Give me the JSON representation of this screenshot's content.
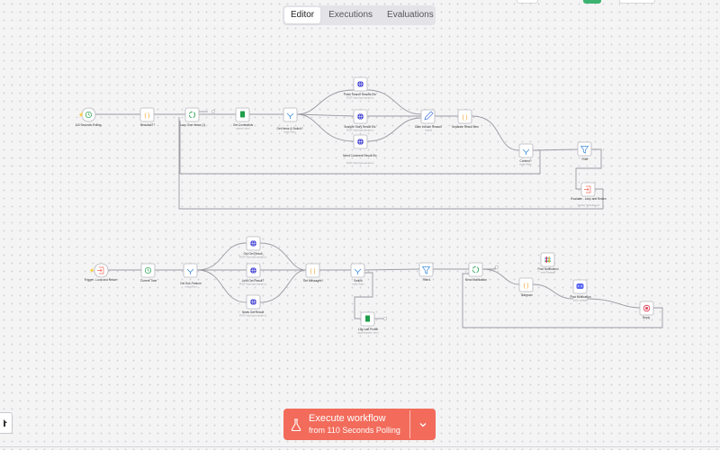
{
  "tabs": [
    {
      "label": "Editor",
      "active": true
    },
    {
      "label": "Executions",
      "active": false
    },
    {
      "label": "Evaluations",
      "active": false
    }
  ],
  "execute": {
    "title": "Execute workflow",
    "subtitle": "from 110 Seconds Polling"
  },
  "colors": {
    "accent": "#f26b5b",
    "trigger": "#f26b5b",
    "http": "#4a4ad6",
    "code": "#f29a1a",
    "sheets": "#1e9e4a",
    "filter": "#3c8ddb",
    "loop": "#1e9e4a",
    "edit": "#3c6fd6",
    "discord": "#5865f2",
    "stop": "#d9304a"
  },
  "nodes": [
    {
      "id": "poll",
      "icon": "clock-icon",
      "label": "110 Seconds Polling",
      "sub": ""
    },
    {
      "id": "result1",
      "icon": "code-icon",
      "label": "ResultsAT?",
      "sub": ""
    },
    {
      "id": "loop1",
      "icon": "loop-icon",
      "label": "Loop Over Items (1)",
      "sub": ""
    },
    {
      "id": "getcontent",
      "icon": "sheets-icon",
      "label": "Get Contentfuls",
      "sub": "append: sheet"
    },
    {
      "id": "getnews",
      "icon": "split-icon",
      "label": "Get News & Switch?",
      "sub": "mode: Rules"
    },
    {
      "id": "fetch",
      "icon": "globe-icon",
      "label": "Fetch Search Results Etc",
      "sub": "POST: https://api.example.io"
    },
    {
      "id": "analyze",
      "icon": "globe-icon",
      "label": "Analyze Story Result Etc",
      "sub": "POST: https://api.example.io"
    },
    {
      "id": "need",
      "icon": "globe-icon",
      "label": "Need Comment Result Etc",
      "sub": "POST: https://api.example.io"
    },
    {
      "id": "editreason",
      "icon": "pencil-icon",
      "label": "Date Include Reason",
      "sub": "manual"
    },
    {
      "id": "separate",
      "icon": "code-icon",
      "label": "Separate Result Item",
      "sub": ""
    },
    {
      "id": "content",
      "icon": "split-icon",
      "label": "Content?",
      "sub": "mode: Rules"
    },
    {
      "id": "filter1",
      "icon": "filter-icon",
      "label": "Filter",
      "sub": ""
    },
    {
      "id": "evaluate",
      "icon": "exit-icon",
      "label": "Evaluate - Loop and Return",
      "sub": "Reorder: Write/Returns"
    },
    {
      "id": "trigger",
      "icon": "exit-icon",
      "label": "Trigger - Loop and Return",
      "sub": ""
    },
    {
      "id": "current",
      "icon": "clock-icon",
      "label": "Current Time",
      "sub": ""
    },
    {
      "id": "getsub",
      "icon": "split-icon",
      "label": "Get Sub-Feature",
      "sub": "mode: Rules"
    },
    {
      "id": "get1",
      "icon": "globe-icon",
      "label": "Get Get Result",
      "sub": "POST: https://api.example.io"
    },
    {
      "id": "get2",
      "icon": "globe-icon",
      "label": "Joint Get Result?",
      "sub": "POST: https://api.example.io"
    },
    {
      "id": "get3",
      "icon": "globe-icon",
      "label": "News Get Result",
      "sub": "POST: https://api.example.io"
    },
    {
      "id": "getmsg",
      "icon": "code-icon",
      "label": "Get Messages?",
      "sub": ""
    },
    {
      "id": "switch",
      "icon": "split-icon",
      "label": "Switch",
      "sub": "mode: Rules"
    },
    {
      "id": "logprofile",
      "icon": "sheets-icon",
      "label": "Log Last Profile",
      "sub": "append/update: sheet"
    },
    {
      "id": "filter2",
      "icon": "filter-icon",
      "label": "Filter1",
      "sub": ""
    },
    {
      "id": "sendnot",
      "icon": "loop-icon",
      "label": "Send Notification",
      "sub": ""
    },
    {
      "id": "telegram",
      "icon": "code-icon",
      "label": "Telegram",
      "sub": ""
    },
    {
      "id": "slack",
      "icon": "slack-icon",
      "label": "Post Notification",
      "sub": "send: message"
    },
    {
      "id": "discord",
      "icon": "discord-icon",
      "label": "Post Notification",
      "sub": "send: message"
    },
    {
      "id": "stop",
      "icon": "stop-icon",
      "label": "Reply",
      "sub": ""
    }
  ]
}
